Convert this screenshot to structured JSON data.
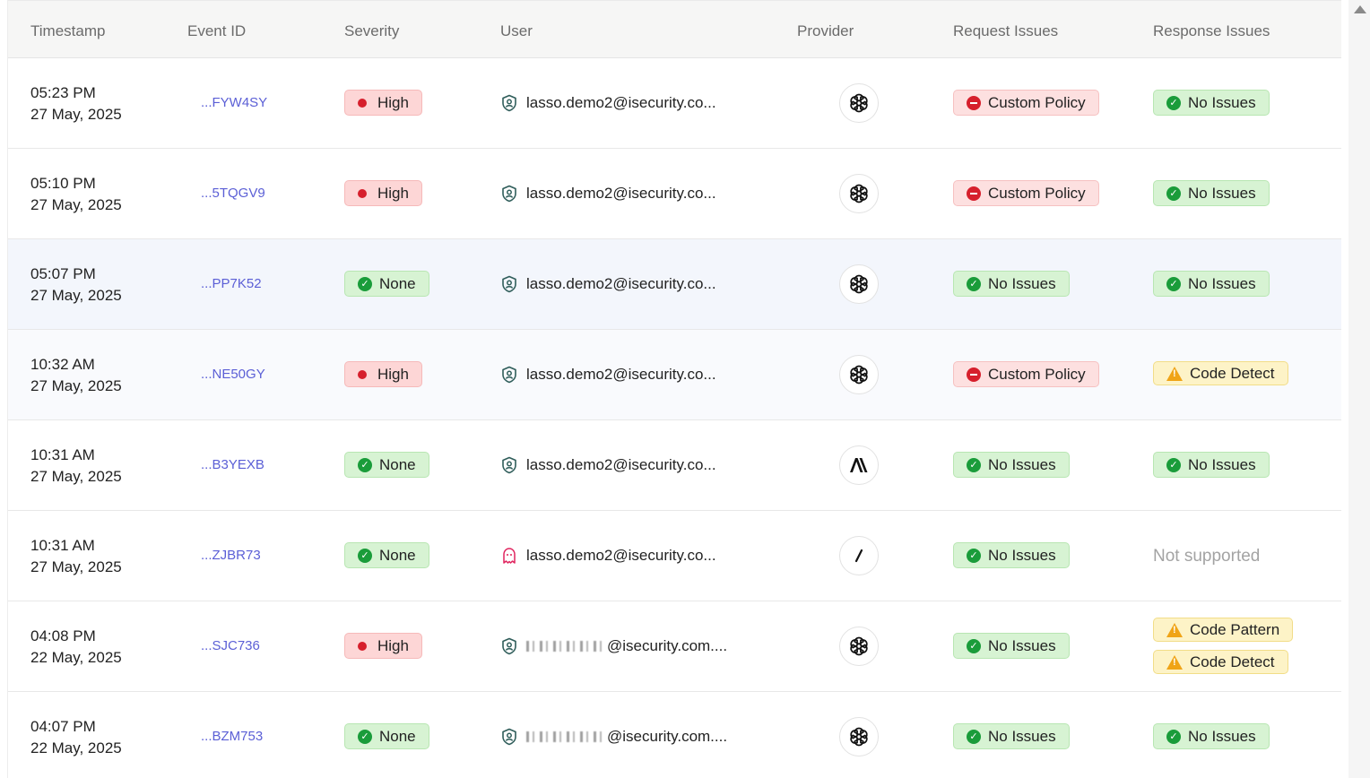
{
  "columns": {
    "timestamp": "Timestamp",
    "event_id": "Event ID",
    "severity": "Severity",
    "user": "User",
    "provider": "Provider",
    "request_issues": "Request Issues",
    "response_issues": "Response Issues"
  },
  "colors": {
    "high": "#d61f2c",
    "ok": "#1a9c3a",
    "warn": "#f0a417",
    "link": "#5b5fd6",
    "highlight_row": "#f3f6fc"
  },
  "rows": [
    {
      "time": "05:23 PM",
      "date": "27 May, 2025",
      "event_id": "...FYW4SY",
      "severity": "High",
      "user": "lasso.demo2@isecurity.co...",
      "user_icon": "shield-user-icon",
      "provider": "openai-icon",
      "request": "Custom Policy",
      "response": [
        "No Issues"
      ]
    },
    {
      "time": "05:10 PM",
      "date": "27 May, 2025",
      "event_id": "...5TQGV9",
      "severity": "High",
      "user": "lasso.demo2@isecurity.co...",
      "user_icon": "shield-user-icon",
      "provider": "openai-icon",
      "request": "Custom Policy",
      "response": [
        "No Issues"
      ]
    },
    {
      "time": "05:07 PM",
      "date": "27 May, 2025",
      "event_id": "...PP7K52",
      "severity": "None",
      "user": "lasso.demo2@isecurity.co...",
      "user_icon": "shield-user-icon",
      "provider": "openai-icon",
      "request": "No Issues",
      "response": [
        "No Issues"
      ]
    },
    {
      "time": "10:32 AM",
      "date": "27 May, 2025",
      "event_id": "...NE50GY",
      "severity": "High",
      "user": "lasso.demo2@isecurity.co...",
      "user_icon": "shield-user-icon",
      "provider": "openai-icon",
      "request": "Custom Policy",
      "response": [
        "Code Detect"
      ]
    },
    {
      "time": "10:31 AM",
      "date": "27 May, 2025",
      "event_id": "...B3YEXB",
      "severity": "None",
      "user": "lasso.demo2@isecurity.co...",
      "user_icon": "shield-user-icon",
      "provider": "anthropic-icon",
      "request": "No Issues",
      "response": [
        "No Issues"
      ]
    },
    {
      "time": "10:31 AM",
      "date": "27 May, 2025",
      "event_id": "...ZJBR73",
      "severity": "None",
      "user": "lasso.demo2@isecurity.co...",
      "user_icon": "ghost-user-icon",
      "provider": "slash-provider-icon",
      "request": "No Issues",
      "response_text": "Not supported"
    },
    {
      "time": "04:08 PM",
      "date": "22 May, 2025",
      "event_id": "...SJC736",
      "severity": "High",
      "user": "@isecurity.com....",
      "user_icon": "shield-user-icon",
      "redacted": true,
      "provider": "openai-icon",
      "request": "No Issues",
      "response": [
        "Code Pattern",
        "Code Detect"
      ]
    },
    {
      "time": "04:07 PM",
      "date": "22 May, 2025",
      "event_id": "...BZM753",
      "severity": "None",
      "user": "@isecurity.com....",
      "user_icon": "shield-user-icon",
      "redacted": true,
      "provider": "openai-icon",
      "request": "No Issues",
      "response": [
        "No Issues"
      ]
    }
  ]
}
